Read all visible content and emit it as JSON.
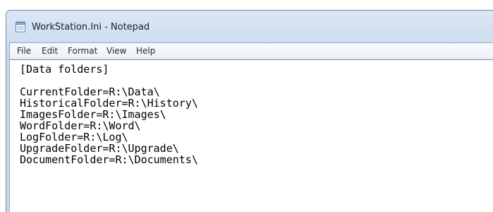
{
  "window": {
    "title": "WorkStation.Ini - Notepad",
    "app_icon": "notepad-icon"
  },
  "menubar": {
    "items": [
      {
        "label": "File"
      },
      {
        "label": "Edit"
      },
      {
        "label": "Format"
      },
      {
        "label": "View"
      },
      {
        "label": "Help"
      }
    ]
  },
  "document": {
    "lines": [
      "[Data folders]",
      "",
      "CurrentFolder=R:\\Data\\",
      "HistoricalFolder=R:\\History\\",
      "ImagesFolder=R:\\Images\\",
      "WordFolder=R:\\Word\\",
      "LogFolder=R:\\Log\\",
      "UpgradeFolder=R:\\Upgrade\\",
      "DocumentFolder=R:\\Documents\\"
    ]
  }
}
